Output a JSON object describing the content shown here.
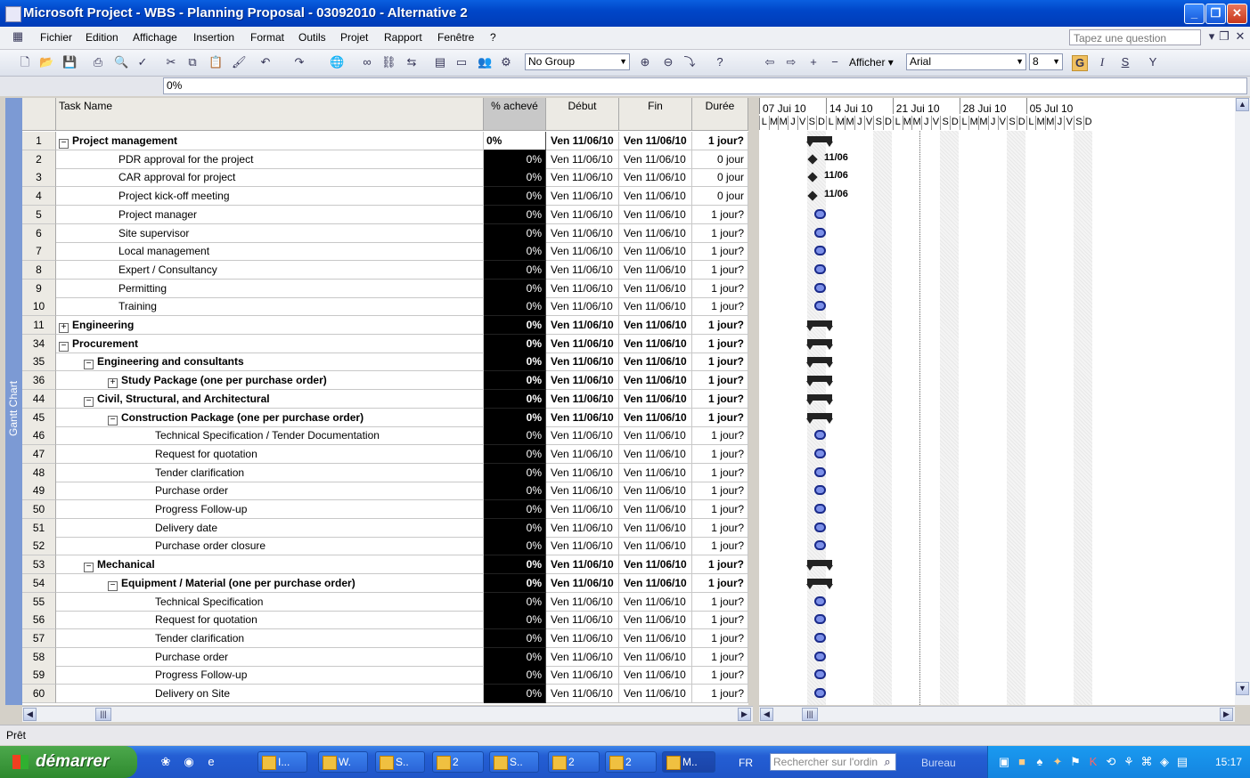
{
  "window": {
    "title": "Microsoft Project - WBS - Planning Proposal - 03092010 - Alternative 2"
  },
  "menu": {
    "items": [
      "Fichier",
      "Edition",
      "Affichage",
      "Insertion",
      "Format",
      "Outils",
      "Projet",
      "Rapport",
      "Fenêtre",
      "?"
    ],
    "ask_placeholder": "Tapez une question"
  },
  "toolbar": {
    "group_select": "No Group",
    "afficher_label": "Afficher ▾",
    "font_name": "Arial",
    "font_size": "8",
    "bold_label": "G",
    "italic_label": "I",
    "underline_label": "S"
  },
  "formula_bar": {
    "value": "0%"
  },
  "side_label": "Gantt Chart",
  "columns": {
    "name": "Task Name",
    "pct": "% achevé",
    "start": "Début",
    "finish": "Fin",
    "duration": "Durée"
  },
  "tasks": [
    {
      "id": "1",
      "name": "Project management",
      "level": 0,
      "type": "summary",
      "expanded": true,
      "pct": "0%",
      "start": "Ven 11/06/10",
      "finish": "Ven 11/06/10",
      "duration": "1 jour?"
    },
    {
      "id": "2",
      "name": "PDR approval for the project",
      "level": 2,
      "type": "milestone",
      "pct": "0%",
      "start": "Ven 11/06/10",
      "finish": "Ven 11/06/10",
      "duration": "0 jour",
      "ms_label": "11/06"
    },
    {
      "id": "3",
      "name": "CAR approval for project",
      "level": 2,
      "type": "milestone",
      "pct": "0%",
      "start": "Ven 11/06/10",
      "finish": "Ven 11/06/10",
      "duration": "0 jour",
      "ms_label": "11/06"
    },
    {
      "id": "4",
      "name": "Project kick-off meeting",
      "level": 2,
      "type": "milestone",
      "pct": "0%",
      "start": "Ven 11/06/10",
      "finish": "Ven 11/06/10",
      "duration": "0 jour",
      "ms_label": "11/06"
    },
    {
      "id": "5",
      "name": "Project manager",
      "level": 2,
      "type": "task",
      "pct": "0%",
      "start": "Ven 11/06/10",
      "finish": "Ven 11/06/10",
      "duration": "1 jour?"
    },
    {
      "id": "6",
      "name": "Site supervisor",
      "level": 2,
      "type": "task",
      "pct": "0%",
      "start": "Ven 11/06/10",
      "finish": "Ven 11/06/10",
      "duration": "1 jour?"
    },
    {
      "id": "7",
      "name": "Local management",
      "level": 2,
      "type": "task",
      "pct": "0%",
      "start": "Ven 11/06/10",
      "finish": "Ven 11/06/10",
      "duration": "1 jour?"
    },
    {
      "id": "8",
      "name": "Expert / Consultancy",
      "level": 2,
      "type": "task",
      "pct": "0%",
      "start": "Ven 11/06/10",
      "finish": "Ven 11/06/10",
      "duration": "1 jour?"
    },
    {
      "id": "9",
      "name": "Permitting",
      "level": 2,
      "type": "task",
      "pct": "0%",
      "start": "Ven 11/06/10",
      "finish": "Ven 11/06/10",
      "duration": "1 jour?"
    },
    {
      "id": "10",
      "name": "Training",
      "level": 2,
      "type": "task",
      "pct": "0%",
      "start": "Ven 11/06/10",
      "finish": "Ven 11/06/10",
      "duration": "1 jour?"
    },
    {
      "id": "11",
      "name": "Engineering",
      "level": 0,
      "type": "summary",
      "expanded": false,
      "pct": "0%",
      "start": "Ven 11/06/10",
      "finish": "Ven 11/06/10",
      "duration": "1 jour?"
    },
    {
      "id": "34",
      "name": "Procurement",
      "level": 0,
      "type": "summary",
      "expanded": true,
      "pct": "0%",
      "start": "Ven 11/06/10",
      "finish": "Ven 11/06/10",
      "duration": "1 jour?"
    },
    {
      "id": "35",
      "name": "Engineering and consultants",
      "level": 1,
      "type": "summary",
      "expanded": true,
      "pct": "0%",
      "start": "Ven 11/06/10",
      "finish": "Ven 11/06/10",
      "duration": "1 jour?"
    },
    {
      "id": "36",
      "name": "Study Package (one per purchase order)",
      "level": 2,
      "type": "summary",
      "expanded": false,
      "pct": "0%",
      "start": "Ven 11/06/10",
      "finish": "Ven 11/06/10",
      "duration": "1 jour?"
    },
    {
      "id": "44",
      "name": "Civil, Structural, and Architectural",
      "level": 1,
      "type": "summary",
      "expanded": true,
      "pct": "0%",
      "start": "Ven 11/06/10",
      "finish": "Ven 11/06/10",
      "duration": "1 jour?"
    },
    {
      "id": "45",
      "name": "Construction Package (one per purchase order)",
      "level": 2,
      "type": "summary",
      "expanded": true,
      "pct": "0%",
      "start": "Ven 11/06/10",
      "finish": "Ven 11/06/10",
      "duration": "1 jour?"
    },
    {
      "id": "46",
      "name": "Technical Specification / Tender Documentation",
      "level": 4,
      "type": "task",
      "pct": "0%",
      "start": "Ven 11/06/10",
      "finish": "Ven 11/06/10",
      "duration": "1 jour?"
    },
    {
      "id": "47",
      "name": "Request for quotation",
      "level": 4,
      "type": "task",
      "pct": "0%",
      "start": "Ven 11/06/10",
      "finish": "Ven 11/06/10",
      "duration": "1 jour?"
    },
    {
      "id": "48",
      "name": "Tender clarification",
      "level": 4,
      "type": "task",
      "pct": "0%",
      "start": "Ven 11/06/10",
      "finish": "Ven 11/06/10",
      "duration": "1 jour?"
    },
    {
      "id": "49",
      "name": "Purchase order",
      "level": 4,
      "type": "task",
      "pct": "0%",
      "start": "Ven 11/06/10",
      "finish": "Ven 11/06/10",
      "duration": "1 jour?"
    },
    {
      "id": "50",
      "name": "Progress Follow-up",
      "level": 4,
      "type": "task",
      "pct": "0%",
      "start": "Ven 11/06/10",
      "finish": "Ven 11/06/10",
      "duration": "1 jour?"
    },
    {
      "id": "51",
      "name": "Delivery date",
      "level": 4,
      "type": "task",
      "pct": "0%",
      "start": "Ven 11/06/10",
      "finish": "Ven 11/06/10",
      "duration": "1 jour?"
    },
    {
      "id": "52",
      "name": "Purchase order closure",
      "level": 4,
      "type": "task",
      "pct": "0%",
      "start": "Ven 11/06/10",
      "finish": "Ven 11/06/10",
      "duration": "1 jour?"
    },
    {
      "id": "53",
      "name": "Mechanical",
      "level": 1,
      "type": "summary",
      "expanded": true,
      "pct": "0%",
      "start": "Ven 11/06/10",
      "finish": "Ven 11/06/10",
      "duration": "1 jour?"
    },
    {
      "id": "54",
      "name": "Equipment / Material (one per purchase order)",
      "level": 2,
      "type": "summary",
      "expanded": true,
      "pct": "0%",
      "start": "Ven 11/06/10",
      "finish": "Ven 11/06/10",
      "duration": "1 jour?"
    },
    {
      "id": "55",
      "name": "Technical Specification",
      "level": 4,
      "type": "task",
      "pct": "0%",
      "start": "Ven 11/06/10",
      "finish": "Ven 11/06/10",
      "duration": "1 jour?"
    },
    {
      "id": "56",
      "name": "Request for quotation",
      "level": 4,
      "type": "task",
      "pct": "0%",
      "start": "Ven 11/06/10",
      "finish": "Ven 11/06/10",
      "duration": "1 jour?"
    },
    {
      "id": "57",
      "name": "Tender clarification",
      "level": 4,
      "type": "task",
      "pct": "0%",
      "start": "Ven 11/06/10",
      "finish": "Ven 11/06/10",
      "duration": "1 jour?"
    },
    {
      "id": "58",
      "name": "Purchase order",
      "level": 4,
      "type": "task",
      "pct": "0%",
      "start": "Ven 11/06/10",
      "finish": "Ven 11/06/10",
      "duration": "1 jour?"
    },
    {
      "id": "59",
      "name": "Progress Follow-up",
      "level": 4,
      "type": "task",
      "pct": "0%",
      "start": "Ven 11/06/10",
      "finish": "Ven 11/06/10",
      "duration": "1 jour?"
    },
    {
      "id": "60",
      "name": "Delivery on Site",
      "level": 4,
      "type": "task",
      "pct": "0%",
      "start": "Ven 11/06/10",
      "finish": "Ven 11/06/10",
      "duration": "1 jour?"
    }
  ],
  "gantt": {
    "weeks": [
      "07 Jui 10",
      "14 Jui 10",
      "21 Jui 10",
      "28 Jui 10",
      "05 Jul 10"
    ],
    "days": [
      "L",
      "M",
      "M",
      "J",
      "V",
      "S",
      "D"
    ],
    "colors": {
      "task_fill": "#7c90e8",
      "task_border": "#1a2a8a",
      "summary": "#222222"
    }
  },
  "status": {
    "text": "Prêt"
  },
  "taskbar": {
    "start_label": "démarrer",
    "buttons": [
      "I...",
      "W.",
      "S..",
      "2",
      "S..",
      "2",
      "2",
      "M.."
    ],
    "lang": "FR",
    "search_placeholder": "Rechercher sur l'ordin",
    "desktop_label": "Bureau",
    "clock": "15:17"
  }
}
